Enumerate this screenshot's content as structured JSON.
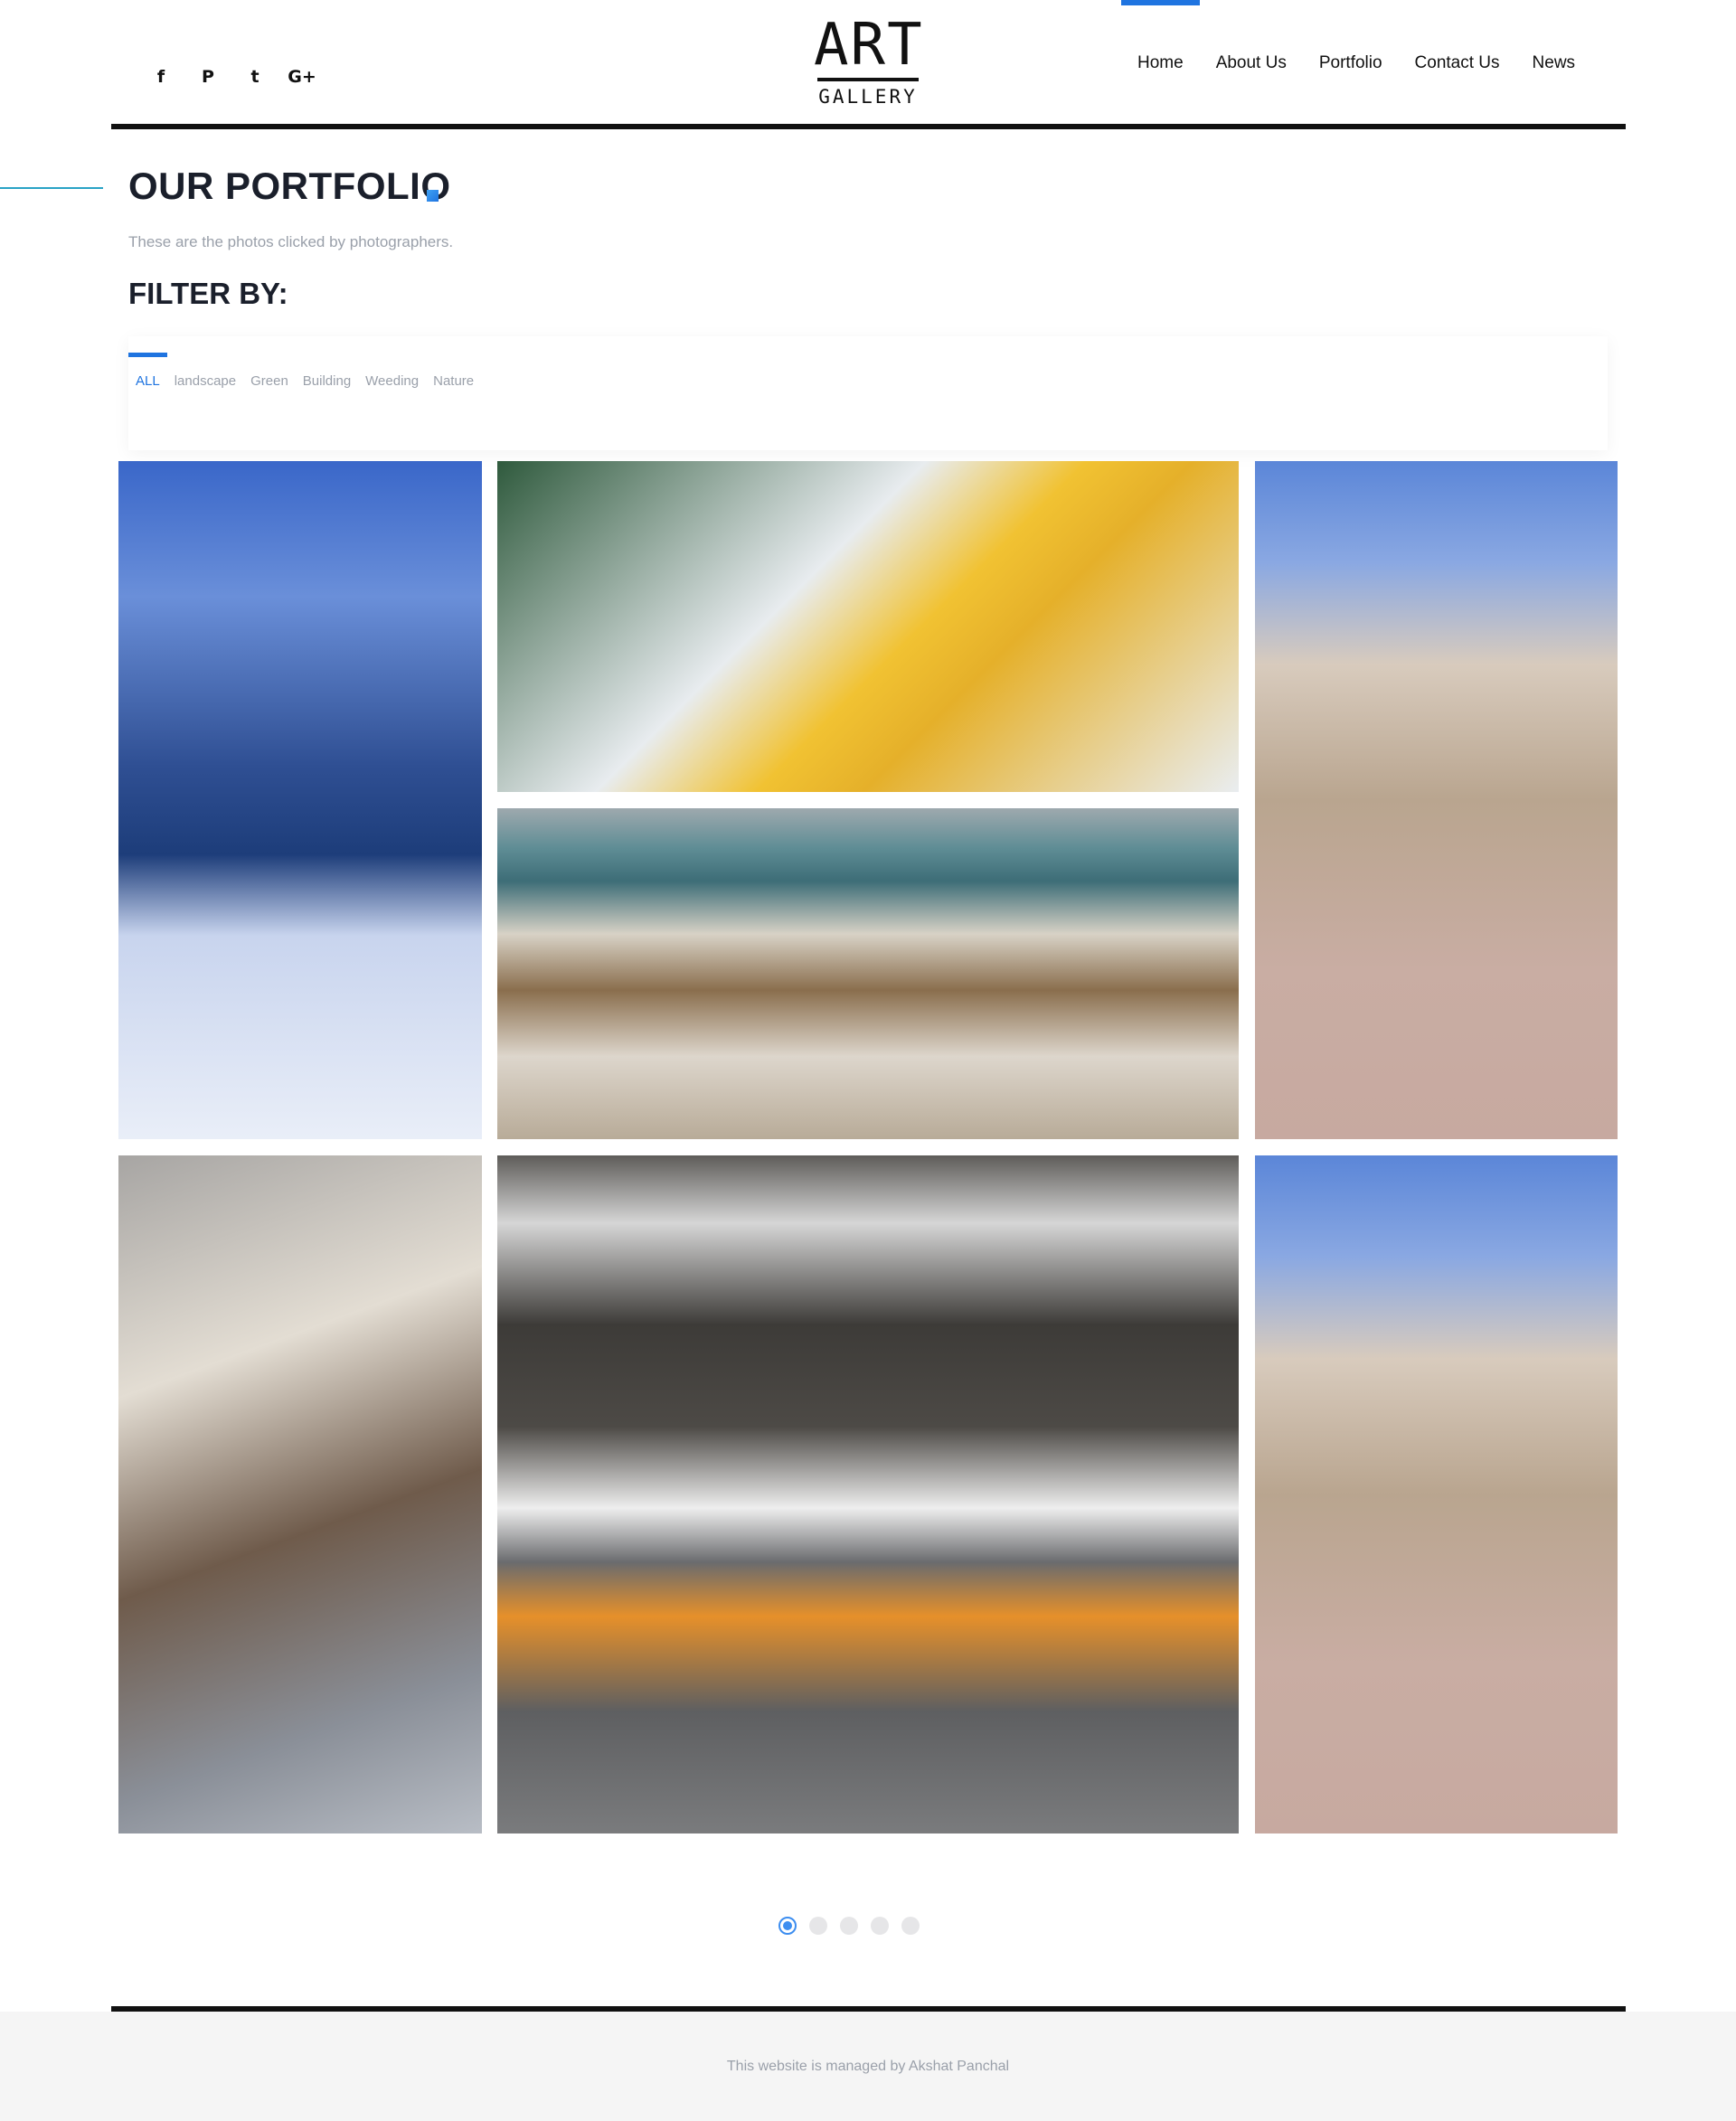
{
  "header": {
    "social": [
      {
        "icon": "facebook-icon",
        "glyph": "f"
      },
      {
        "icon": "pinterest-icon",
        "glyph": "P"
      },
      {
        "icon": "twitter-icon",
        "glyph": "t"
      },
      {
        "icon": "google-plus-icon",
        "glyph": "G+"
      }
    ],
    "logo": {
      "line1": "ART",
      "line2": "GALLERY"
    },
    "nav": [
      "Home",
      "About Us",
      "Portfolio",
      "Contact Us",
      "News"
    ],
    "active_nav": "Home"
  },
  "section": {
    "title": "OUR PORTFOLIO",
    "subtitle": "These are the photos clicked by photographers.",
    "filter_heading": "FILTER BY:"
  },
  "filters": {
    "tabs": [
      "ALL",
      "landscape",
      "Green",
      "Building",
      "Weeding",
      "Nature"
    ],
    "active": "ALL"
  },
  "gallery": {
    "images": [
      {
        "subject": "person walking on snowy lakeside with mountains"
      },
      {
        "subject": "photographer in yellow jacket with camera in snow"
      },
      {
        "subject": "two hikers with backpacks in canyon"
      },
      {
        "subject": "wooden boardwalk to beach"
      },
      {
        "subject": "sliced stollen bread on wooden board"
      },
      {
        "subject": "oranges, candle and sparklers on knit blanket"
      },
      {
        "subject": "two hikers with backpacks in canyon"
      }
    ]
  },
  "pagination": {
    "pages": 5,
    "current": 1
  },
  "colors": {
    "accent": "#1f74e0",
    "teal_line": "#29a3c6",
    "text_dark": "#1a1f2b",
    "text_muted": "#9aa0aa"
  },
  "footer": {
    "text": "This website is managed by Akshat Panchal"
  }
}
